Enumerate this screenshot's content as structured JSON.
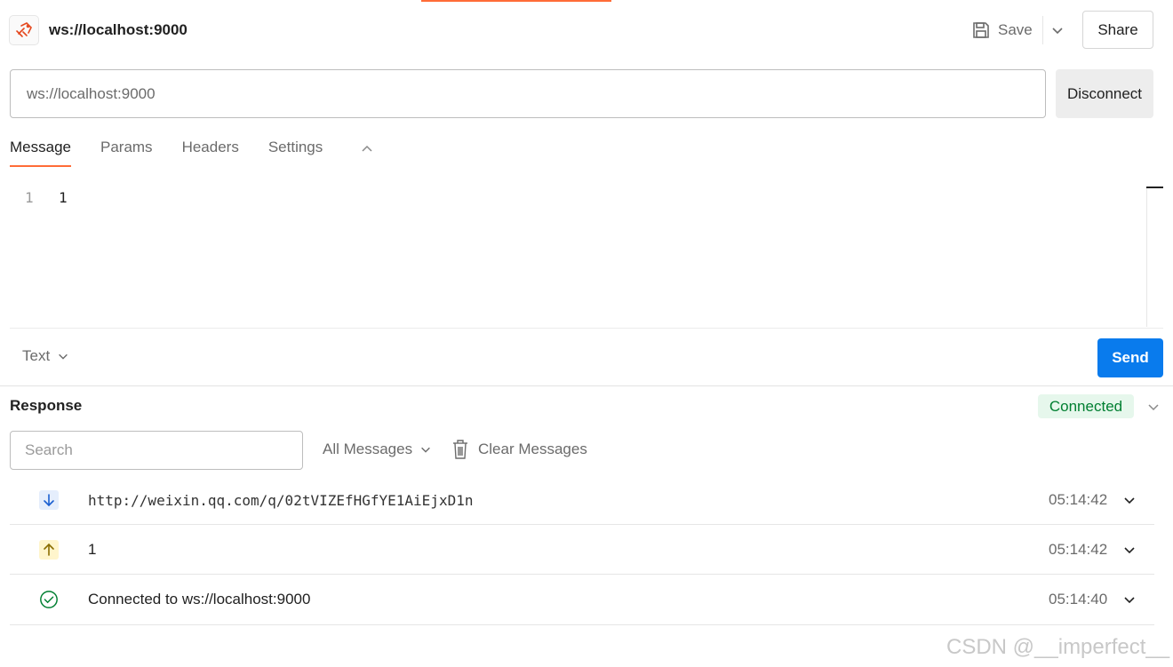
{
  "header": {
    "title": "ws://localhost:9000",
    "save_label": "Save",
    "share_label": "Share"
  },
  "url_bar": {
    "value": "ws://localhost:9000",
    "disconnect_label": "Disconnect"
  },
  "tabs": [
    {
      "label": "Message",
      "active": true
    },
    {
      "label": "Params",
      "active": false
    },
    {
      "label": "Headers",
      "active": false
    },
    {
      "label": "Settings",
      "active": false
    }
  ],
  "editor": {
    "line_number": "1",
    "content": "1",
    "type_label": "Text",
    "send_label": "Send"
  },
  "response": {
    "title": "Response",
    "status": "Connected",
    "search_placeholder": "Search",
    "filter_label": "All Messages",
    "clear_label": "Clear Messages",
    "messages": [
      {
        "direction": "incoming",
        "icon": "arrow-down-icon",
        "text": "http://weixin.qq.com/q/02tVIZEfHGfYE1AiEjxD1n",
        "time": "05:14:42"
      },
      {
        "direction": "outgoing",
        "icon": "arrow-up-icon",
        "text": "1",
        "time": "05:14:42"
      },
      {
        "direction": "connected",
        "icon": "check-circle-icon",
        "text": "Connected to ws://localhost:9000",
        "time": "05:14:40"
      }
    ]
  },
  "colors": {
    "accent": "#ff6c37",
    "primary": "#097bed",
    "success_bg": "#e6f7ec",
    "success_text": "#007f31"
  },
  "watermark": "CSDN @__imperfect__"
}
